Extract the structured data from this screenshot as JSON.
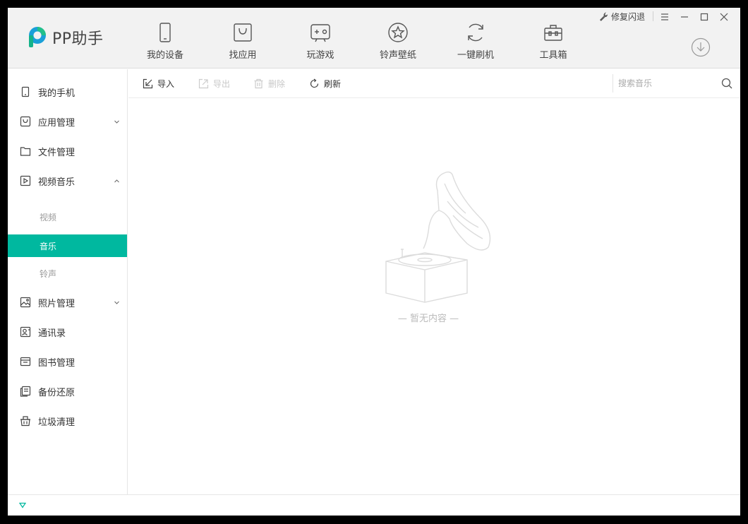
{
  "app": {
    "logo_text": "PP助手"
  },
  "nav": [
    {
      "label": "我的设备",
      "icon": "phone-icon"
    },
    {
      "label": "找应用",
      "icon": "app-bag-icon"
    },
    {
      "label": "玩游戏",
      "icon": "gamepad-icon"
    },
    {
      "label": "铃声壁纸",
      "icon": "star-icon"
    },
    {
      "label": "一键刷机",
      "icon": "refresh-cycle-icon"
    },
    {
      "label": "工具箱",
      "icon": "toolbox-icon"
    }
  ],
  "window": {
    "repair_label": "修复闪退"
  },
  "sidebar": {
    "items": [
      {
        "label": "我的手机",
        "icon": "phone-icon"
      },
      {
        "label": "应用管理",
        "icon": "app-bag-icon",
        "chevron": "down"
      },
      {
        "label": "文件管理",
        "icon": "folder-icon"
      },
      {
        "label": "视频音乐",
        "icon": "play-icon",
        "chevron": "up"
      },
      {
        "label": "照片管理",
        "icon": "photo-icon",
        "chevron": "down"
      },
      {
        "label": "通讯录",
        "icon": "contacts-icon"
      },
      {
        "label": "图书管理",
        "icon": "books-icon"
      },
      {
        "label": "备份还原",
        "icon": "backup-icon"
      },
      {
        "label": "垃圾清理",
        "icon": "trash-basket-icon"
      }
    ],
    "sub_items": [
      {
        "label": "视频",
        "active": false
      },
      {
        "label": "音乐",
        "active": true
      },
      {
        "label": "铃声",
        "active": false
      }
    ]
  },
  "toolbar": {
    "import_label": "导入",
    "export_label": "导出",
    "delete_label": "删除",
    "refresh_label": "刷新",
    "search_placeholder": "搜索音乐"
  },
  "content": {
    "empty_text": "— 暂无内容 —"
  },
  "colors": {
    "accent": "#00b89f",
    "header_bg": "#f2f2f2"
  }
}
